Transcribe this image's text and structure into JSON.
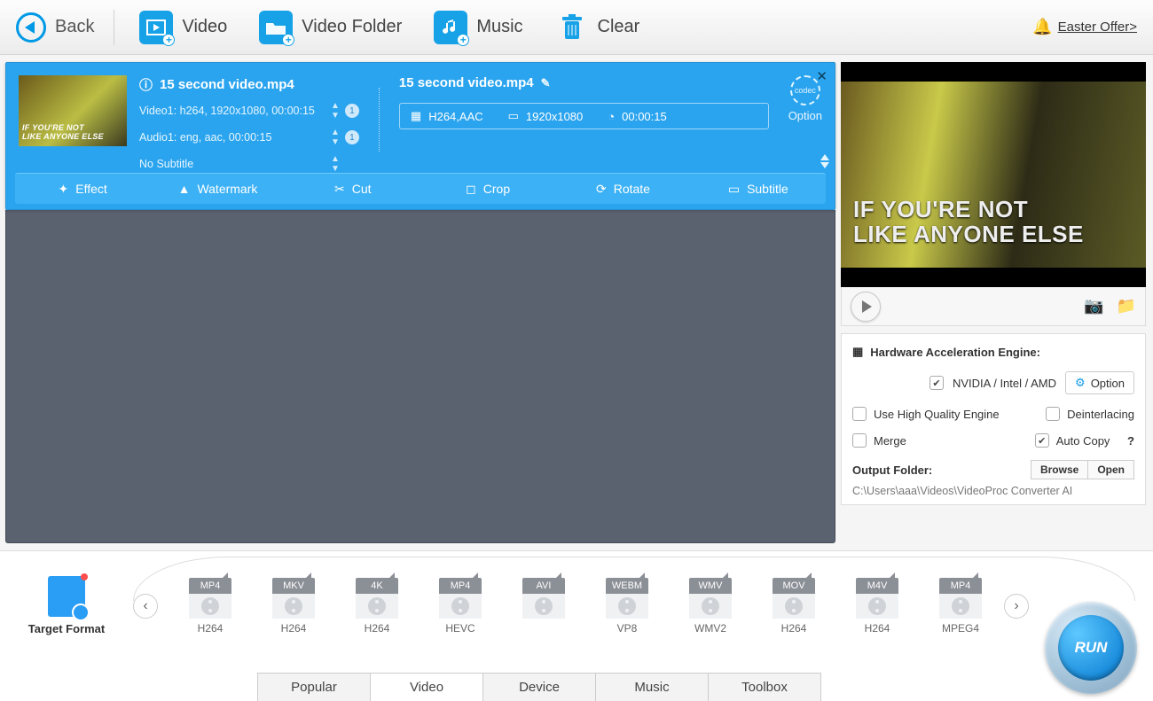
{
  "topbar": {
    "back": "Back",
    "buttons": [
      {
        "label": "Video"
      },
      {
        "label": "Video Folder"
      },
      {
        "label": "Music"
      },
      {
        "label": "Clear"
      }
    ],
    "easter": "Easter Offer>"
  },
  "card": {
    "src_title": "15 second video.mp4",
    "video_line": "Video1: h264, 1920x1080, 00:00:15",
    "audio_line": "Audio1: eng, aac, 00:00:15",
    "sub_line": "No Subtitle",
    "count_v": "1",
    "count_a": "1",
    "dst_title": "15 second video.mp4",
    "codec": "H264,AAC",
    "size": "1920x1080",
    "dur": "00:00:15",
    "codec_btn": "Option",
    "ops": [
      "Effect",
      "Watermark",
      "Cut",
      "Crop",
      "Rotate",
      "Subtitle"
    ],
    "thumb_text": "IF YOU'RE NOT\nLIKE ANYONE ELSE"
  },
  "preview": {
    "caption": "IF YOU'RE NOT\nLIKE ANYONE ELSE"
  },
  "panel": {
    "hw_title": "Hardware Acceleration Engine:",
    "hw_label": "NVIDIA / Intel / AMD",
    "option": "Option",
    "hq": "Use High Quality Engine",
    "deint": "Deinterlacing",
    "merge": "Merge",
    "autocopy": "Auto Copy",
    "of_title": "Output Folder:",
    "browse": "Browse",
    "open": "Open",
    "path": "C:\\Users\\aaa\\Videos\\VideoProc Converter AI"
  },
  "bottom": {
    "target": "Target Format",
    "formats": [
      {
        "top": "MP4",
        "bot": "H264"
      },
      {
        "top": "MKV",
        "bot": "H264"
      },
      {
        "top": "4K",
        "bot": "H264"
      },
      {
        "top": "MP4",
        "bot": "HEVC"
      },
      {
        "top": "AVI",
        "bot": ""
      },
      {
        "top": "WEBM",
        "bot": "VP8"
      },
      {
        "top": "WMV",
        "bot": "WMV2"
      },
      {
        "top": "MOV",
        "bot": "H264"
      },
      {
        "top": "M4V",
        "bot": "H264"
      },
      {
        "top": "MP4",
        "bot": "MPEG4"
      }
    ],
    "cats": [
      "Popular",
      "Video",
      "Device",
      "Music",
      "Toolbox"
    ],
    "active_cat": "Video",
    "run": "RUN"
  }
}
